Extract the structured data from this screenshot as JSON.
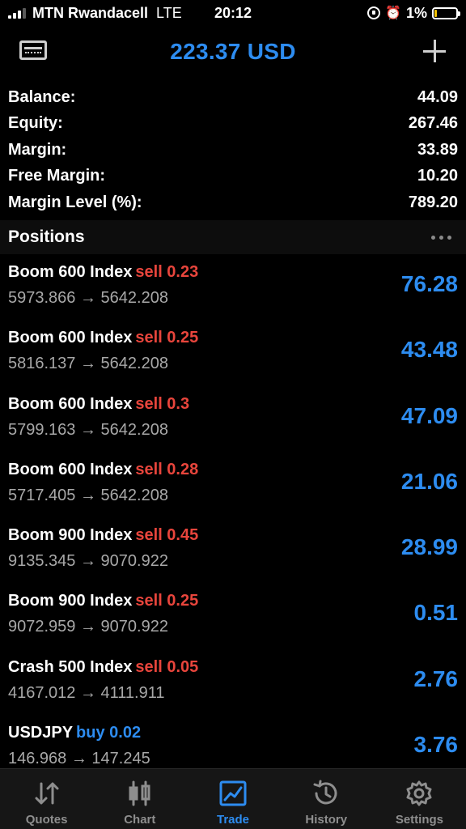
{
  "status_bar": {
    "carrier": "MTN Rwandacell",
    "network": "LTE",
    "time": "20:12",
    "battery": "1%"
  },
  "header": {
    "title": "223.37 USD",
    "account_icon": "account-card-icon",
    "add_icon": "plus-icon"
  },
  "summary": [
    {
      "label": "Balance:",
      "value": "44.09"
    },
    {
      "label": "Equity:",
      "value": "267.46"
    },
    {
      "label": "Margin:",
      "value": "33.89"
    },
    {
      "label": "Free Margin:",
      "value": "10.20"
    },
    {
      "label": "Margin Level (%):",
      "value": "789.20"
    }
  ],
  "positions": {
    "title": "Positions",
    "items": [
      {
        "symbol": "Boom 600 Index",
        "type": "sell 0.23",
        "side": "sell",
        "prices": "5973.866 → 5642.208",
        "profit": "76.28"
      },
      {
        "symbol": "Boom 600 Index",
        "type": "sell 0.25",
        "side": "sell",
        "prices": "5816.137 → 5642.208",
        "profit": "43.48"
      },
      {
        "symbol": "Boom 600 Index",
        "type": "sell 0.3",
        "side": "sell",
        "prices": "5799.163 → 5642.208",
        "profit": "47.09"
      },
      {
        "symbol": "Boom 600 Index",
        "type": "sell 0.28",
        "side": "sell",
        "prices": "5717.405 → 5642.208",
        "profit": "21.06"
      },
      {
        "symbol": "Boom 900 Index",
        "type": "sell 0.45",
        "side": "sell",
        "prices": "9135.345 → 9070.922",
        "profit": "28.99"
      },
      {
        "symbol": "Boom 900 Index",
        "type": "sell 0.25",
        "side": "sell",
        "prices": "9072.959 → 9070.922",
        "profit": "0.51"
      },
      {
        "symbol": "Crash 500 Index",
        "type": "sell 0.05",
        "side": "sell",
        "prices": "4167.012 → 4111.911",
        "profit": "2.76"
      },
      {
        "symbol": "USDJPY",
        "type": "buy 0.02",
        "side": "buy",
        "prices": "146.968 → 147.245",
        "profit": "3.76"
      }
    ]
  },
  "tabs": [
    {
      "label": "Quotes",
      "icon": "quotes-arrows-icon",
      "active": false
    },
    {
      "label": "Chart",
      "icon": "candlestick-chart-icon",
      "active": false
    },
    {
      "label": "Trade",
      "icon": "trade-chart-icon",
      "active": true
    },
    {
      "label": "History",
      "icon": "history-clock-icon",
      "active": false
    },
    {
      "label": "Settings",
      "icon": "settings-gear-icon",
      "active": false
    }
  ],
  "colors": {
    "accent": "#2d8cf0",
    "sell": "#e8453c",
    "background": "#000000"
  }
}
